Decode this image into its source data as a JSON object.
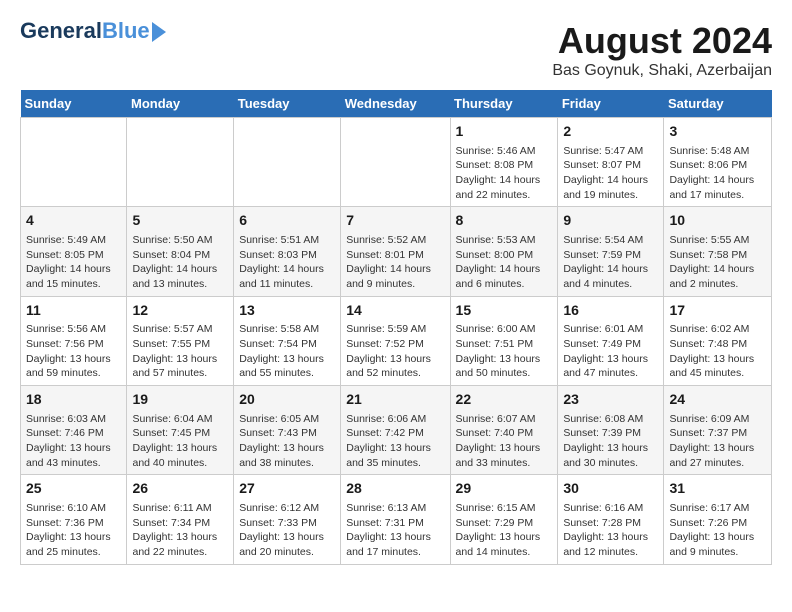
{
  "header": {
    "logo_line1": "General",
    "logo_line2": "Blue",
    "title": "August 2024",
    "subtitle": "Bas Goynuk, Shaki, Azerbaijan"
  },
  "days_of_week": [
    "Sunday",
    "Monday",
    "Tuesday",
    "Wednesday",
    "Thursday",
    "Friday",
    "Saturday"
  ],
  "weeks": [
    [
      {
        "day": "",
        "info": ""
      },
      {
        "day": "",
        "info": ""
      },
      {
        "day": "",
        "info": ""
      },
      {
        "day": "",
        "info": ""
      },
      {
        "day": "1",
        "info": "Sunrise: 5:46 AM\nSunset: 8:08 PM\nDaylight: 14 hours and 22 minutes."
      },
      {
        "day": "2",
        "info": "Sunrise: 5:47 AM\nSunset: 8:07 PM\nDaylight: 14 hours and 19 minutes."
      },
      {
        "day": "3",
        "info": "Sunrise: 5:48 AM\nSunset: 8:06 PM\nDaylight: 14 hours and 17 minutes."
      }
    ],
    [
      {
        "day": "4",
        "info": "Sunrise: 5:49 AM\nSunset: 8:05 PM\nDaylight: 14 hours and 15 minutes."
      },
      {
        "day": "5",
        "info": "Sunrise: 5:50 AM\nSunset: 8:04 PM\nDaylight: 14 hours and 13 minutes."
      },
      {
        "day": "6",
        "info": "Sunrise: 5:51 AM\nSunset: 8:03 PM\nDaylight: 14 hours and 11 minutes."
      },
      {
        "day": "7",
        "info": "Sunrise: 5:52 AM\nSunset: 8:01 PM\nDaylight: 14 hours and 9 minutes."
      },
      {
        "day": "8",
        "info": "Sunrise: 5:53 AM\nSunset: 8:00 PM\nDaylight: 14 hours and 6 minutes."
      },
      {
        "day": "9",
        "info": "Sunrise: 5:54 AM\nSunset: 7:59 PM\nDaylight: 14 hours and 4 minutes."
      },
      {
        "day": "10",
        "info": "Sunrise: 5:55 AM\nSunset: 7:58 PM\nDaylight: 14 hours and 2 minutes."
      }
    ],
    [
      {
        "day": "11",
        "info": "Sunrise: 5:56 AM\nSunset: 7:56 PM\nDaylight: 13 hours and 59 minutes."
      },
      {
        "day": "12",
        "info": "Sunrise: 5:57 AM\nSunset: 7:55 PM\nDaylight: 13 hours and 57 minutes."
      },
      {
        "day": "13",
        "info": "Sunrise: 5:58 AM\nSunset: 7:54 PM\nDaylight: 13 hours and 55 minutes."
      },
      {
        "day": "14",
        "info": "Sunrise: 5:59 AM\nSunset: 7:52 PM\nDaylight: 13 hours and 52 minutes."
      },
      {
        "day": "15",
        "info": "Sunrise: 6:00 AM\nSunset: 7:51 PM\nDaylight: 13 hours and 50 minutes."
      },
      {
        "day": "16",
        "info": "Sunrise: 6:01 AM\nSunset: 7:49 PM\nDaylight: 13 hours and 47 minutes."
      },
      {
        "day": "17",
        "info": "Sunrise: 6:02 AM\nSunset: 7:48 PM\nDaylight: 13 hours and 45 minutes."
      }
    ],
    [
      {
        "day": "18",
        "info": "Sunrise: 6:03 AM\nSunset: 7:46 PM\nDaylight: 13 hours and 43 minutes."
      },
      {
        "day": "19",
        "info": "Sunrise: 6:04 AM\nSunset: 7:45 PM\nDaylight: 13 hours and 40 minutes."
      },
      {
        "day": "20",
        "info": "Sunrise: 6:05 AM\nSunset: 7:43 PM\nDaylight: 13 hours and 38 minutes."
      },
      {
        "day": "21",
        "info": "Sunrise: 6:06 AM\nSunset: 7:42 PM\nDaylight: 13 hours and 35 minutes."
      },
      {
        "day": "22",
        "info": "Sunrise: 6:07 AM\nSunset: 7:40 PM\nDaylight: 13 hours and 33 minutes."
      },
      {
        "day": "23",
        "info": "Sunrise: 6:08 AM\nSunset: 7:39 PM\nDaylight: 13 hours and 30 minutes."
      },
      {
        "day": "24",
        "info": "Sunrise: 6:09 AM\nSunset: 7:37 PM\nDaylight: 13 hours and 27 minutes."
      }
    ],
    [
      {
        "day": "25",
        "info": "Sunrise: 6:10 AM\nSunset: 7:36 PM\nDaylight: 13 hours and 25 minutes."
      },
      {
        "day": "26",
        "info": "Sunrise: 6:11 AM\nSunset: 7:34 PM\nDaylight: 13 hours and 22 minutes."
      },
      {
        "day": "27",
        "info": "Sunrise: 6:12 AM\nSunset: 7:33 PM\nDaylight: 13 hours and 20 minutes."
      },
      {
        "day": "28",
        "info": "Sunrise: 6:13 AM\nSunset: 7:31 PM\nDaylight: 13 hours and 17 minutes."
      },
      {
        "day": "29",
        "info": "Sunrise: 6:15 AM\nSunset: 7:29 PM\nDaylight: 13 hours and 14 minutes."
      },
      {
        "day": "30",
        "info": "Sunrise: 6:16 AM\nSunset: 7:28 PM\nDaylight: 13 hours and 12 minutes."
      },
      {
        "day": "31",
        "info": "Sunrise: 6:17 AM\nSunset: 7:26 PM\nDaylight: 13 hours and 9 minutes."
      }
    ]
  ]
}
